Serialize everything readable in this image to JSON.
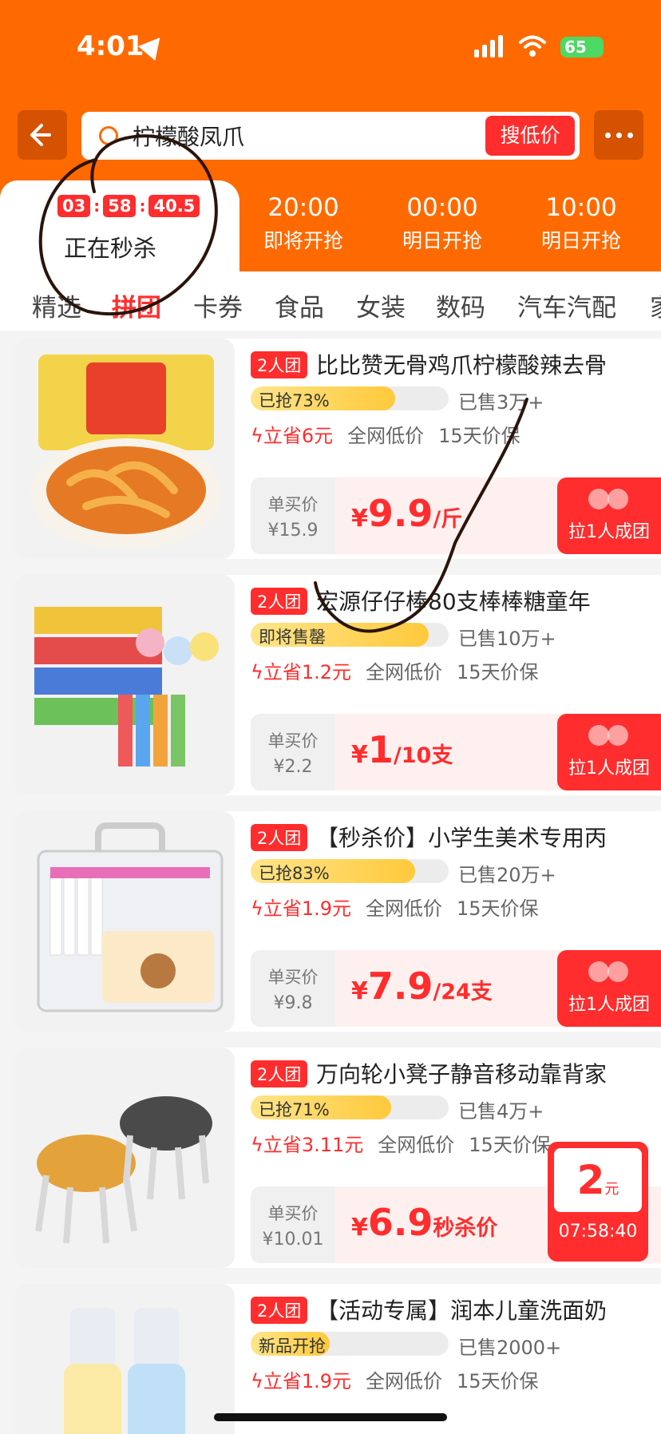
{
  "status": {
    "time": "4:01",
    "battery": "65"
  },
  "search": {
    "query": "柠檬酸凤爪",
    "button": "搜低价"
  },
  "sessions": {
    "active": {
      "hh": "03",
      "mm": "58",
      "ss": "40.5",
      "label": "正在秒杀"
    },
    "upcoming": [
      {
        "time": "20:00",
        "label": "即将开抢"
      },
      {
        "time": "00:00",
        "label": "明日开抢"
      },
      {
        "time": "10:00",
        "label": "明日开抢"
      }
    ]
  },
  "categories": [
    "精选",
    "拼团",
    "卡券",
    "食品",
    "女装",
    "数码",
    "汽车汽配",
    "家"
  ],
  "active_category": "拼团",
  "products": [
    {
      "badge": "2人团",
      "title": "比比赞无骨鸡爪柠檬酸辣去骨",
      "progress_label": "已抢73%",
      "progress": 0.73,
      "sold": "已售3万+",
      "save": "立省6元",
      "lowest": "全网低价",
      "guarantee": "15天价保",
      "single_label": "单买价",
      "single_price": "¥15.9",
      "currency": "¥",
      "price": "9.9",
      "unit": "/斤",
      "group_label": "拉1人成团"
    },
    {
      "badge": "2人团",
      "title": "宏源仔仔棒80支棒棒糖童年",
      "progress_label": "即将售罄",
      "progress": 0.9,
      "sold": "已售10万+",
      "save": "立省1.2元",
      "lowest": "全网低价",
      "guarantee": "15天价保",
      "single_label": "单买价",
      "single_price": "¥2.2",
      "currency": "¥",
      "price": "1",
      "unit": "/10支",
      "group_label": "拉1人成团"
    },
    {
      "badge": "2人团",
      "title": "【秒杀价】小学生美术专用丙",
      "progress_label": "已抢83%",
      "progress": 0.83,
      "sold": "已售20万+",
      "save": "立省1.9元",
      "lowest": "全网低价",
      "guarantee": "15天价保",
      "single_label": "单买价",
      "single_price": "¥9.8",
      "currency": "¥",
      "price": "7.9",
      "unit": "/24支",
      "group_label": "拉1人成团"
    },
    {
      "badge": "2人团",
      "title": "万向轮小凳子静音移动靠背家",
      "progress_label": "已抢71%",
      "progress": 0.71,
      "sold": "已售4万+",
      "save": "立省3.11元",
      "lowest": "全网低价",
      "guarantee": "15天价保",
      "single_label": "单买价",
      "single_price": "¥10.01",
      "currency": "¥",
      "price": "6.9",
      "unit": "秒杀价",
      "group_label": ""
    },
    {
      "badge": "2人团",
      "title": "【活动专属】润本儿童洗面奶",
      "progress_label": "新品开抢",
      "progress": 0.4,
      "sold": "已售2000+",
      "save": "立省1.9元",
      "lowest": "全网低价",
      "guarantee": "15天价保",
      "single_label": "",
      "single_price": "",
      "currency": "",
      "price": "",
      "unit": "",
      "group_label": ""
    }
  ],
  "float_coupon": {
    "amount": "2",
    "unit": "元",
    "countdown": "07:58:40"
  },
  "colors": {
    "brand_orange": "#ff6a00",
    "accent_red": "#ff2d2d"
  }
}
